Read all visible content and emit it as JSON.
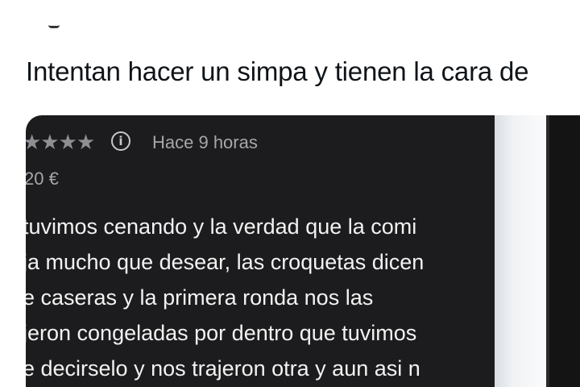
{
  "post": {
    "text": "Intentan hacer un simpa y tienen la cara de"
  },
  "review": {
    "stars": "★★★★",
    "info_icon": "info-circle-icon",
    "time_ago": "Hace 9 horas",
    "price": "20 €",
    "lines": [
      "tuvimos cenando y la verdad que la comi",
      "ja mucho que desear, las croquetas dicen",
      "e caseras y la primera ronda nos las",
      "jeron congeladas por dentro que tuvimos",
      "e decirselo y nos trajeron otra y aun asi n"
    ]
  },
  "colors": {
    "background": "#ffffff",
    "post_text": "#0f1419",
    "review_card": "#1c1c1e",
    "review_text": "#f2f2f2",
    "meta_text": "#a6a6ab"
  }
}
